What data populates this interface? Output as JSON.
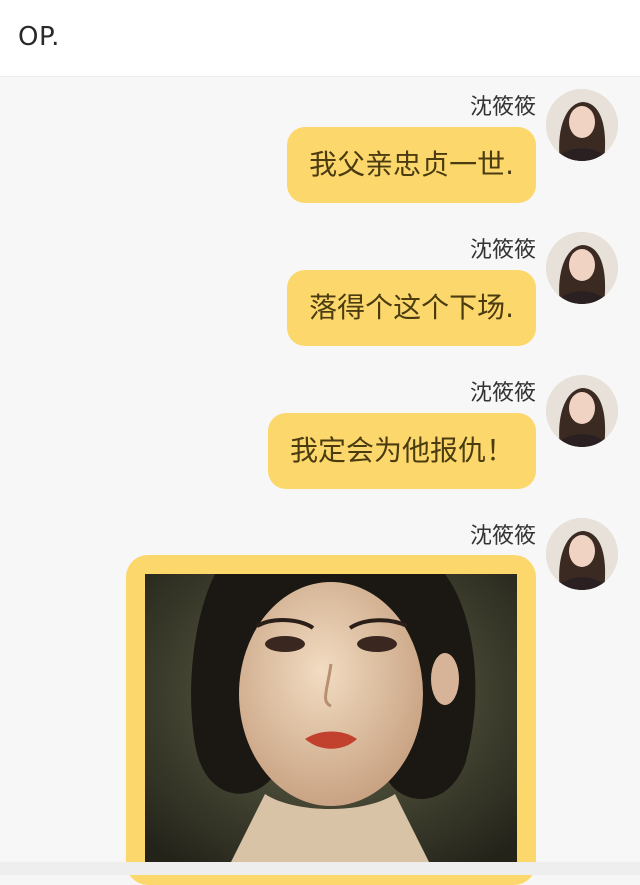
{
  "header": {
    "title": "OP."
  },
  "messages": [
    {
      "sender": "沈筱筱",
      "text": "我父亲忠贞一世."
    },
    {
      "sender": "沈筱筱",
      "text": "落得个这个下场."
    },
    {
      "sender": "沈筱筱",
      "text": "我定会为他报仇！"
    },
    {
      "sender": "沈筱筱",
      "text": ""
    }
  ],
  "colors": {
    "bubble": "#fcd86c",
    "background": "#f7f7f7",
    "header_background": "#ffffff"
  },
  "icons": {
    "avatar": "avatar-icon"
  }
}
